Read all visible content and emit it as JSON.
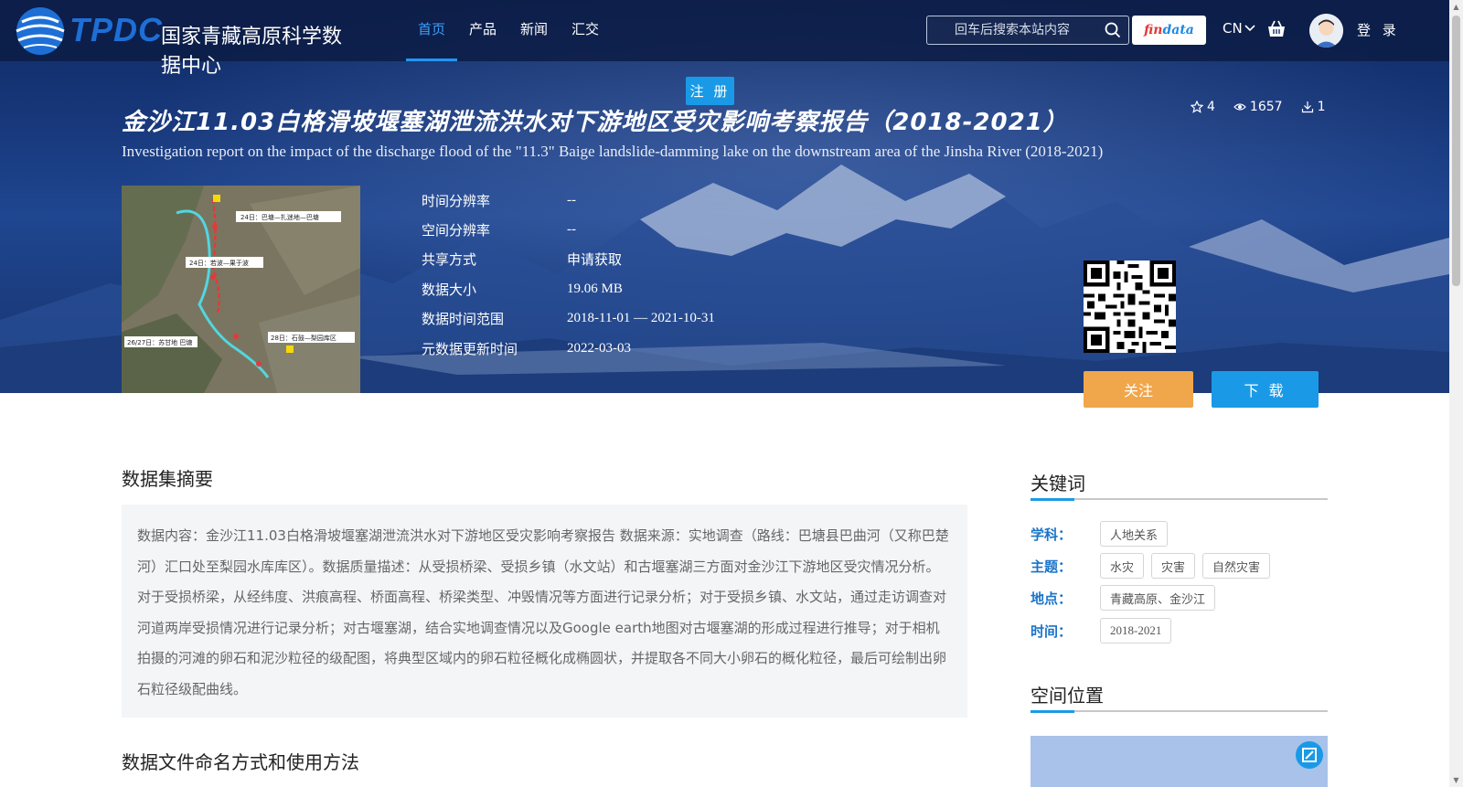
{
  "brand": {
    "logo_text": "TPDC",
    "name": "国家青藏高原科学数据中心"
  },
  "nav": {
    "items": [
      {
        "label": "首页",
        "active": true
      },
      {
        "label": "产品",
        "active": false
      },
      {
        "label": "新闻",
        "active": false
      },
      {
        "label": "汇交",
        "active": false
      }
    ]
  },
  "search": {
    "placeholder": "回车后搜索本站内容",
    "icon": "search-icon"
  },
  "findata": {
    "part1": "fin",
    "part2": "data"
  },
  "lang": {
    "label": "CN"
  },
  "login": {
    "label": "登 录"
  },
  "register": {
    "label": "注 册"
  },
  "dataset": {
    "title": "金沙江11.03白格滑坡堰塞湖泄流洪水对下游地区受灾影响考察报告（2018-2021）",
    "subtitle": "Investigation report on the impact of the discharge flood of the \"11.3\" Baige landslide-damming lake on the downstream area of the Jinsha River (2018-2021)",
    "stats": {
      "stars": "4",
      "views": "1657",
      "downloads": "1"
    },
    "meta": [
      {
        "key": "时间分辨率",
        "value": "--"
      },
      {
        "key": "空间分辨率",
        "value": "--"
      },
      {
        "key": "共享方式",
        "value": "申请获取"
      },
      {
        "key": "数据大小",
        "value": "19.06 MB"
      },
      {
        "key": "数据时间范围",
        "value": "2018-11-01 — 2021-10-31"
      },
      {
        "key": "元数据更新时间",
        "value": "2022-03-03"
      }
    ],
    "thumbnail_labels": [
      "24日：巴塘—扎迷地—巴塘",
      "24日：若波—果于波",
      "26/27日：苏甘地  巴塘",
      "28日：石鼓—梨园库区"
    ],
    "follow_label": "关注",
    "download_label": "下 载"
  },
  "abstract": {
    "heading": "数据集摘要",
    "text": "数据内容：金沙江11.03白格滑坡堰塞湖泄流洪水对下游地区受灾影响考察报告 数据来源：实地调查（路线：巴塘县巴曲河（又称巴楚河）汇口处至梨园水库库区）。数据质量描述：从受损桥梁、受损乡镇（水文站）和古堰塞湖三方面对金沙江下游地区受灾情况分析。对于受损桥梁，从经纬度、洪痕高程、桥面高程、桥梁类型、冲毁情况等方面进行记录分析；对于受损乡镇、水文站，通过走访调查对河道两岸受损情况进行记录分析；对古堰塞湖，结合实地调查情况以及Google earth地图对古堰塞湖的形成过程进行推导；对于相机拍摄的河滩的卵石和泥沙粒径的级配图，将典型区域内的卵石粒径概化成椭圆状，并提取各不同大小卵石的概化粒径，最后可绘制出卵石粒径级配曲线。"
  },
  "naming": {
    "heading": "数据文件命名方式和使用方法"
  },
  "keywords": {
    "heading": "关键词",
    "rows": [
      {
        "label": "学科：",
        "tags": [
          "人地关系"
        ]
      },
      {
        "label": "主题：",
        "tags": [
          "水灾",
          "灾害",
          "自然灾害"
        ]
      },
      {
        "label": "地点：",
        "tags": [
          "青藏高原、金沙江"
        ]
      },
      {
        "label": "时间：",
        "tags": [
          "2018-2021"
        ]
      }
    ]
  },
  "location": {
    "heading": "空间位置"
  },
  "colors": {
    "accent": "#1a9ae6",
    "follow": "#f0a64a",
    "nav_active": "#3aa0ff"
  }
}
